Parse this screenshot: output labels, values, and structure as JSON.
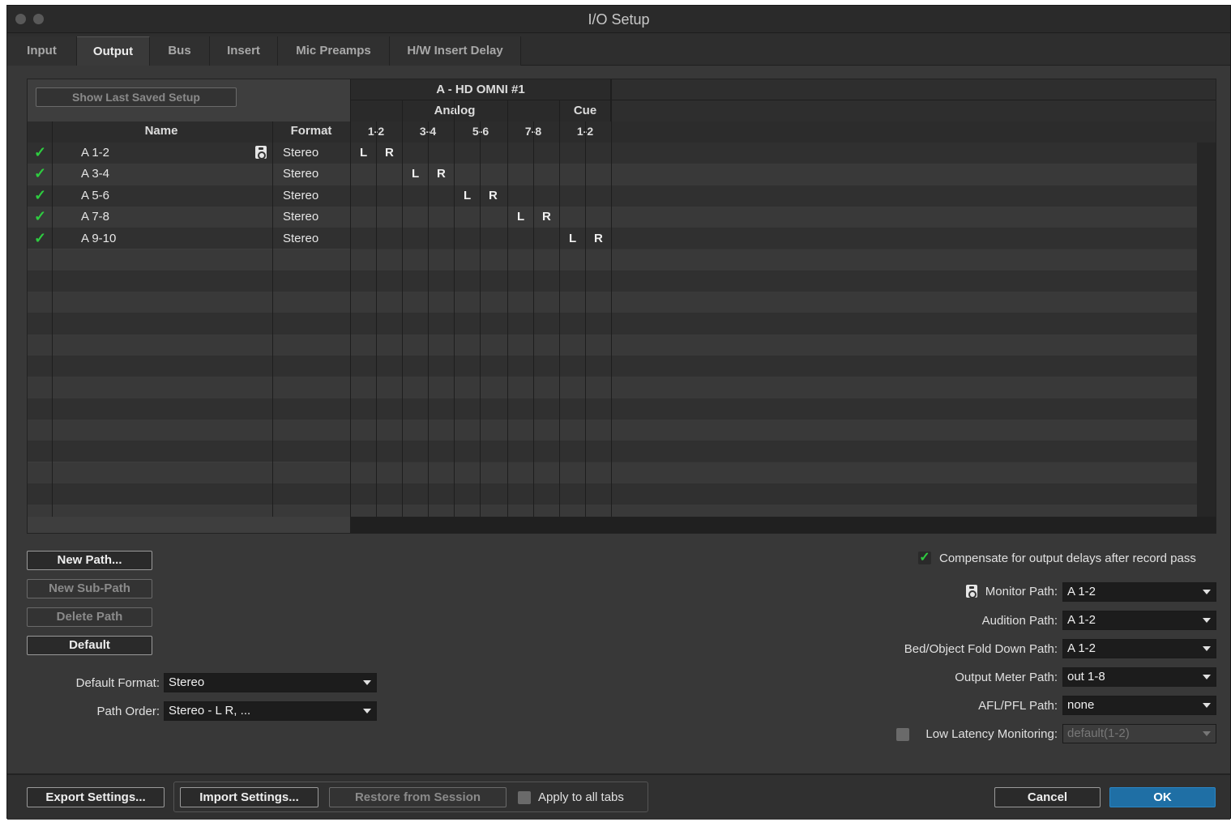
{
  "window": {
    "title": "I/O Setup"
  },
  "tabs": [
    {
      "label": "Input"
    },
    {
      "label": "Output"
    },
    {
      "label": "Bus"
    },
    {
      "label": "Insert"
    },
    {
      "label": "Mic Preamps"
    },
    {
      "label": "H/W Insert Delay"
    }
  ],
  "active_tab": "Output",
  "show_last_saved": "Show Last Saved Setup",
  "grid": {
    "device": "A - HD OMNI #1",
    "group_analog": "Analog",
    "group_cue": "Cue",
    "col_name": "Name",
    "col_format": "Format",
    "channels": [
      "1-2",
      "3-4",
      "5-6",
      "7-8",
      "1-2"
    ],
    "left_label": "L",
    "right_label": "R",
    "rows": [
      {
        "name": "A 1-2",
        "format": "Stereo"
      },
      {
        "name": "A 3-4",
        "format": "Stereo"
      },
      {
        "name": "A 5-6",
        "format": "Stereo"
      },
      {
        "name": "A 7-8",
        "format": "Stereo"
      },
      {
        "name": "A 9-10",
        "format": "Stereo"
      }
    ]
  },
  "buttons": {
    "new_path": "New Path...",
    "new_sub_path": "New Sub-Path",
    "delete_path": "Delete Path",
    "default": "Default",
    "export": "Export Settings...",
    "import": "Import Settings...",
    "restore": "Restore from Session",
    "cancel": "Cancel",
    "ok": "OK"
  },
  "defaults": {
    "format_label": "Default Format:",
    "format_value": "Stereo",
    "order_label": "Path Order:",
    "order_value": "Stereo - L R, ..."
  },
  "right_settings": {
    "compensate": "Compensate for output delays after record pass",
    "monitor_label": "Monitor Path:",
    "monitor_value": "A 1-2",
    "audition_label": "Audition Path:",
    "audition_value": "A 1-2",
    "fold_label": "Bed/Object Fold Down Path:",
    "fold_value": "A 1-2",
    "meter_label": "Output Meter Path:",
    "meter_value": "out 1-8",
    "afl_label": "AFL/PFL Path:",
    "afl_value": "none",
    "low_latency_label": "Low Latency Monitoring:",
    "low_latency_value": "default(1-2)"
  },
  "apply_all": "Apply to all tabs",
  "checkmark": "✓"
}
